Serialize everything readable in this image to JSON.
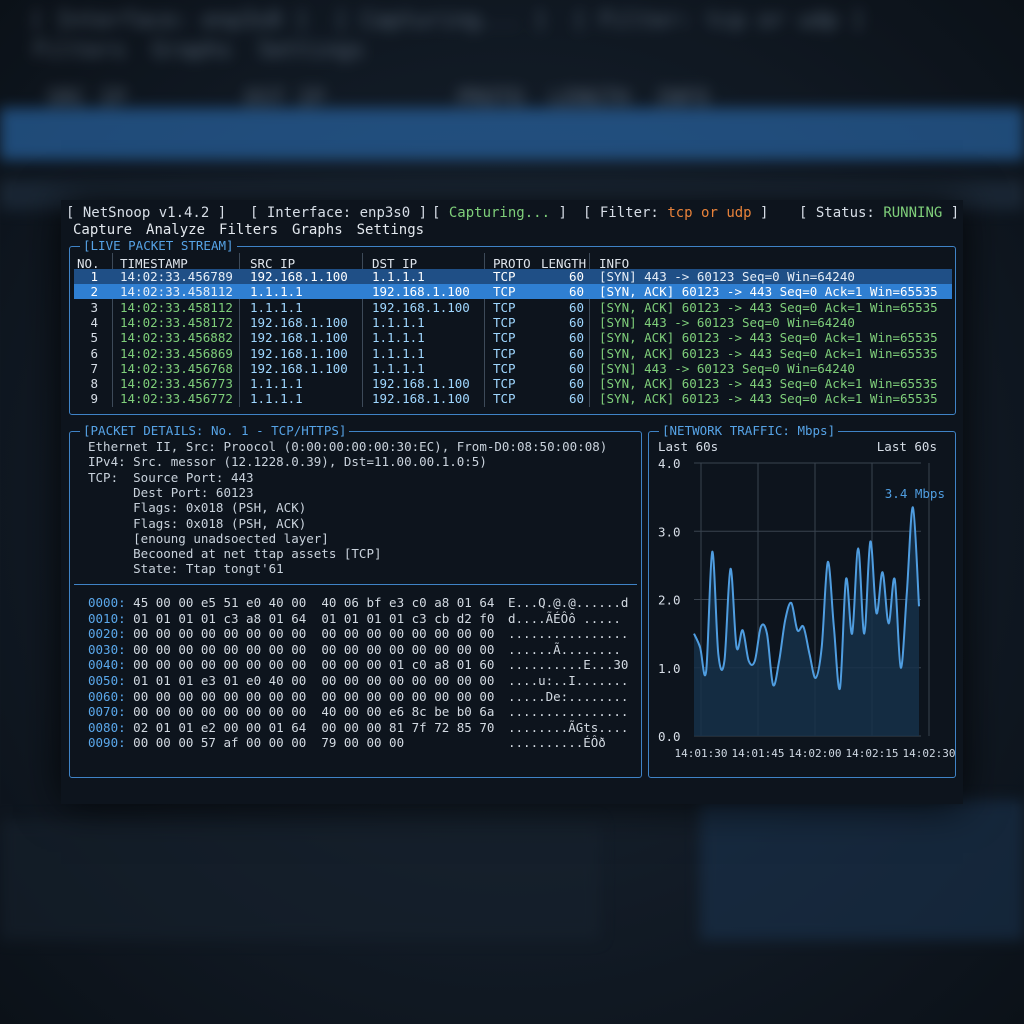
{
  "app": {
    "name": "NetSnoop v1.4.2",
    "interface_label": "Interface:",
    "interface": "enp3s0",
    "capture_state": "Capturing...",
    "filter_label": "Filter:",
    "filter": "tcp or udp",
    "status_label": "Status:",
    "status": "RUNNING"
  },
  "menu": [
    "Capture",
    "Analyze",
    "Filters",
    "Graphs",
    "Settings"
  ],
  "stream": {
    "title": "LIVE PACKET STREAM",
    "columns": [
      "NO.",
      "TIMESTAMP",
      "SRC IP",
      "DST IP",
      "PROTO",
      "LENGTH",
      "INFO"
    ],
    "rows": [
      {
        "no": "1",
        "ts": "14:02:33.456789",
        "src": "192.168.1.100",
        "dst": "1.1.1.1",
        "proto": "TCP",
        "len": "60",
        "info": "[SYN] 443 -> 60123 Seq=0 Win=64240"
      },
      {
        "no": "2",
        "ts": "14:02:33.458112",
        "src": "1.1.1.1",
        "dst": "192.168.1.100",
        "proto": "TCP",
        "len": "60",
        "info": "[SYN, ACK] 60123 -> 443 Seq=0 Ack=1 Win=65535"
      },
      {
        "no": "3",
        "ts": "14:02:33.458112",
        "src": "1.1.1.1",
        "dst": "192.168.1.100",
        "proto": "TCP",
        "len": "60",
        "info": "[SYN, ACK] 60123 -> 443 Seq=0 Ack=1 Win=65535"
      },
      {
        "no": "4",
        "ts": "14:02:33.458172",
        "src": "192.168.1.100",
        "dst": "1.1.1.1",
        "proto": "TCP",
        "len": "60",
        "info": "[SYN] 443 -> 60123 Seq=0 Win=64240"
      },
      {
        "no": "5",
        "ts": "14:02:33.456882",
        "src": "192.168.1.100",
        "dst": "1.1.1.1",
        "proto": "TCP",
        "len": "60",
        "info": "[SYN, ACK] 60123 -> 443 Seq=0 Ack=1 Win=65535"
      },
      {
        "no": "6",
        "ts": "14:02:33.456869",
        "src": "192.168.1.100",
        "dst": "1.1.1.1",
        "proto": "TCP",
        "len": "60",
        "info": "[SYN, ACK] 60123 -> 443 Seq=0 Ack=1 Win=65535"
      },
      {
        "no": "7",
        "ts": "14:02:33.456768",
        "src": "192.168.1.100",
        "dst": "1.1.1.1",
        "proto": "TCP",
        "len": "60",
        "info": "[SYN] 443 -> 60123 Seq=0 Win=64240"
      },
      {
        "no": "8",
        "ts": "14:02:33.456773",
        "src": "1.1.1.1",
        "dst": "192.168.1.100",
        "proto": "TCP",
        "len": "60",
        "info": "[SYN, ACK] 60123 -> 443 Seq=0 Ack=1 Win=65535"
      },
      {
        "no": "9",
        "ts": "14:02:33.456772",
        "src": "1.1.1.1",
        "dst": "192.168.1.100",
        "proto": "TCP",
        "len": "60",
        "info": "[SYN, ACK] 60123 -> 443 Seq=0 Ack=1 Win=65535"
      }
    ]
  },
  "details": {
    "title": "PACKET DETAILS: No. 1 - TCP/HTTPS",
    "lines": [
      "Ethernet II, Src: Proocol (0:00:00:00:00:30:EC), From-D0:08:50:00:08)",
      "IPv4: Src. messor (12.1228.0.39), Dst=11.00.00.1.0:5)",
      "TCP:  Source Port: 443",
      "      Dest Port: 60123",
      "      Flags: 0x018 (PSH, ACK)",
      "      Flags: 0x018 (PSH, ACK)",
      "      [enoung unadsoected layer]",
      "      Becooned at net ttap assets [TCP]",
      "      State: Ttap tongt'61"
    ],
    "hex": [
      {
        "off": "0000:",
        "bytes": "45 00 00 e5 51 e0 40 00  40 06 bf e3 c0 a8 01 64",
        "ascii": "E...Q.@.@......d"
      },
      {
        "off": "0010:",
        "bytes": "01 01 01 01 c3 a8 01 64  01 01 01 01 c3 cb d2 f0",
        "ascii": "d....ÃÉÔô ....."
      },
      {
        "off": "0020:",
        "bytes": "00 00 00 00 00 00 00 00  00 00 00 00 00 00 00 00",
        "ascii": "................"
      },
      {
        "off": "0030:",
        "bytes": "00 00 00 00 00 00 00 00  00 00 00 00 00 00 00 00",
        "ascii": "......Ã........"
      },
      {
        "off": "0040:",
        "bytes": "00 00 00 00 00 00 00 00  00 00 00 01 c0 a8 01 60",
        "ascii": "..........E...30"
      },
      {
        "off": "0050:",
        "bytes": "01 01 01 e3 01 e0 40 00  00 00 00 00 00 00 00 00",
        "ascii": "....u:..I......."
      },
      {
        "off": "0060:",
        "bytes": "00 00 00 00 00 00 00 00  00 00 00 00 00 00 00 00",
        "ascii": ".....De:........"
      },
      {
        "off": "0070:",
        "bytes": "00 00 00 00 00 00 00 00  40 00 00 e6 8c be b0 6a",
        "ascii": "................"
      },
      {
        "off": "0080:",
        "bytes": "02 01 01 e2 00 00 01 64  00 00 00 81 7f 72 85 70",
        "ascii": "........ÃGts...."
      },
      {
        "off": "0090:",
        "bytes": "00 00 00 57 af 00 00 00  79 00 00 00",
        "ascii": "..........ÉÔð"
      }
    ]
  },
  "traffic": {
    "title": "NETWORK TRAFFIC: Mbps",
    "left_caption": "Last 60s",
    "right_caption": "Last 60s",
    "current_label": "3.4 Mbps",
    "chart_data": {
      "type": "area",
      "ylim": [
        0,
        4.0
      ],
      "yticks": [
        "4.0",
        "3.0",
        "2.0",
        "1.0",
        "0.0"
      ],
      "xticks": [
        "14:01:30",
        "14:01:45",
        "14:02:00",
        "14:02:15",
        "14:02:30"
      ],
      "values": [
        1.5,
        1.3,
        0.95,
        2.7,
        1.2,
        1.1,
        2.45,
        1.3,
        1.55,
        1.1,
        1.1,
        1.6,
        1.5,
        0.75,
        1.1,
        1.7,
        1.95,
        1.55,
        1.6,
        1.2,
        0.85,
        1.3,
        2.55,
        1.6,
        0.7,
        2.3,
        1.5,
        2.75,
        1.5,
        2.85,
        1.8,
        2.4,
        1.65,
        2.3,
        1.0,
        2.1,
        3.35,
        1.9
      ],
      "line_color": "#4f9de0",
      "fill_color": "#163049"
    }
  },
  "background": {
    "lines": [
      "[ Interface: enp3s0 ]  [ Capturing... ]  [ Filter: tcp or udp ]",
      " Filters  Graphs  Settings",
      "  SRC IP         DST IP          PROTO  LENGTH  INFO"
    ]
  }
}
